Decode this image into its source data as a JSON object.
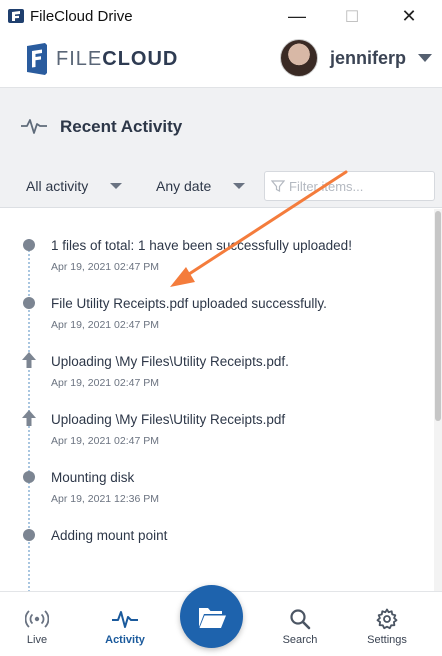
{
  "window": {
    "title": "FileCloud Drive",
    "controls": {
      "minimize": "—",
      "maximize": "☐",
      "close": "✕"
    }
  },
  "header": {
    "logo_text_light": "FILE",
    "logo_text_bold": "CLOUD",
    "username": "jenniferp"
  },
  "section": {
    "title": "Recent Activity"
  },
  "filters": {
    "activity_label": "All activity",
    "date_label": "Any date",
    "search_placeholder": "Filter items..."
  },
  "activity": [
    {
      "icon": "dot-icon",
      "message": "1 files of total: 1 have been successfully uploaded!",
      "time": "Apr 19, 2021 02:47 PM"
    },
    {
      "icon": "dot-icon",
      "message": "File Utility Receipts.pdf uploaded successfully.",
      "time": "Apr 19, 2021 02:47 PM"
    },
    {
      "icon": "upload-arrow-icon",
      "message": "Uploading \\My Files\\Utility Receipts.pdf.",
      "time": "Apr 19, 2021 02:47 PM"
    },
    {
      "icon": "upload-arrow-icon",
      "message": "Uploading \\My Files\\Utility Receipts.pdf",
      "time": "Apr 19, 2021 02:47 PM"
    },
    {
      "icon": "dot-icon",
      "message": "Mounting disk",
      "time": "Apr 19, 2021 12:36 PM"
    },
    {
      "icon": "dot-icon",
      "message": "Adding mount point",
      "time": ""
    }
  ],
  "nav": {
    "live": "Live",
    "activity": "Activity",
    "search": "Search",
    "settings": "Settings"
  },
  "colors": {
    "accent": "#1e63ad",
    "annotation_arrow": "#f47c3c",
    "timeline_line": "#a9c6e0"
  }
}
